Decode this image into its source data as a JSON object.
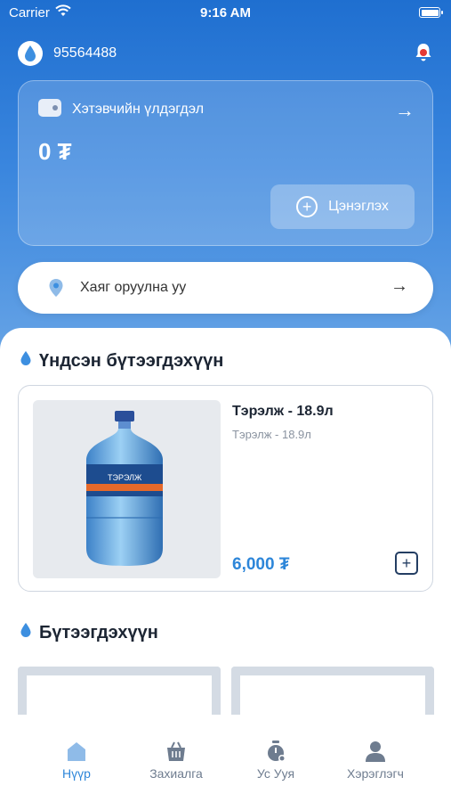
{
  "status_bar": {
    "carrier": "Carrier",
    "time": "9:16 AM"
  },
  "header": {
    "phone": "95564488"
  },
  "wallet": {
    "title": "Хэтэвчийн үлдэгдэл",
    "balance": "0 ₮",
    "topup_label": "Цэнэглэх"
  },
  "address": {
    "placeholder": "Хаяг оруулна уу"
  },
  "main_section": {
    "title": "Үндсэн бүтээгдэхүүн",
    "product": {
      "name": "Тэрэлж - 18.9л",
      "subtitle": "Тэрэлж - 18.9л",
      "price": "6,000 ₮",
      "bottle_label": "ТЭРЭЛЖ"
    }
  },
  "products_section": {
    "title": "Бүтээгдэхүүн"
  },
  "tabs": [
    {
      "label": "Нүүр",
      "icon": "home-icon",
      "active": true
    },
    {
      "label": "Захиалга",
      "icon": "basket-icon",
      "active": false
    },
    {
      "label": "Ус Ууя",
      "icon": "timer-icon",
      "active": false
    },
    {
      "label": "Хэрэглэгч",
      "icon": "user-icon",
      "active": false
    }
  ],
  "colors": {
    "accent": "#2d86d9",
    "hero_top": "#1f6fd0",
    "hero_bottom": "#6aa6e6",
    "notification": "#e53935"
  }
}
